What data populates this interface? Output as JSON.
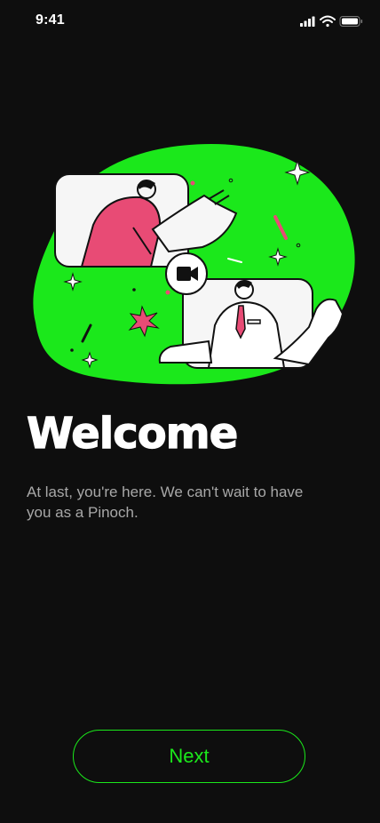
{
  "status_bar": {
    "time": "9:41",
    "icons": [
      "cellular-signal-icon",
      "wifi-icon",
      "battery-icon"
    ]
  },
  "illustration": {
    "name": "video-call-illustration",
    "accent_color": "#1be81b",
    "figure_color": "#e84b75",
    "icon": "video-camera-icon"
  },
  "content": {
    "title": "Welcome",
    "body": "At last, you're here. We can't wait to have you as a Pinoch."
  },
  "actions": {
    "next_label": "Next"
  },
  "colors": {
    "background": "#0e0e0e",
    "accent": "#1be81b",
    "text_primary": "#ffffff",
    "text_secondary": "#a8a8a8"
  }
}
